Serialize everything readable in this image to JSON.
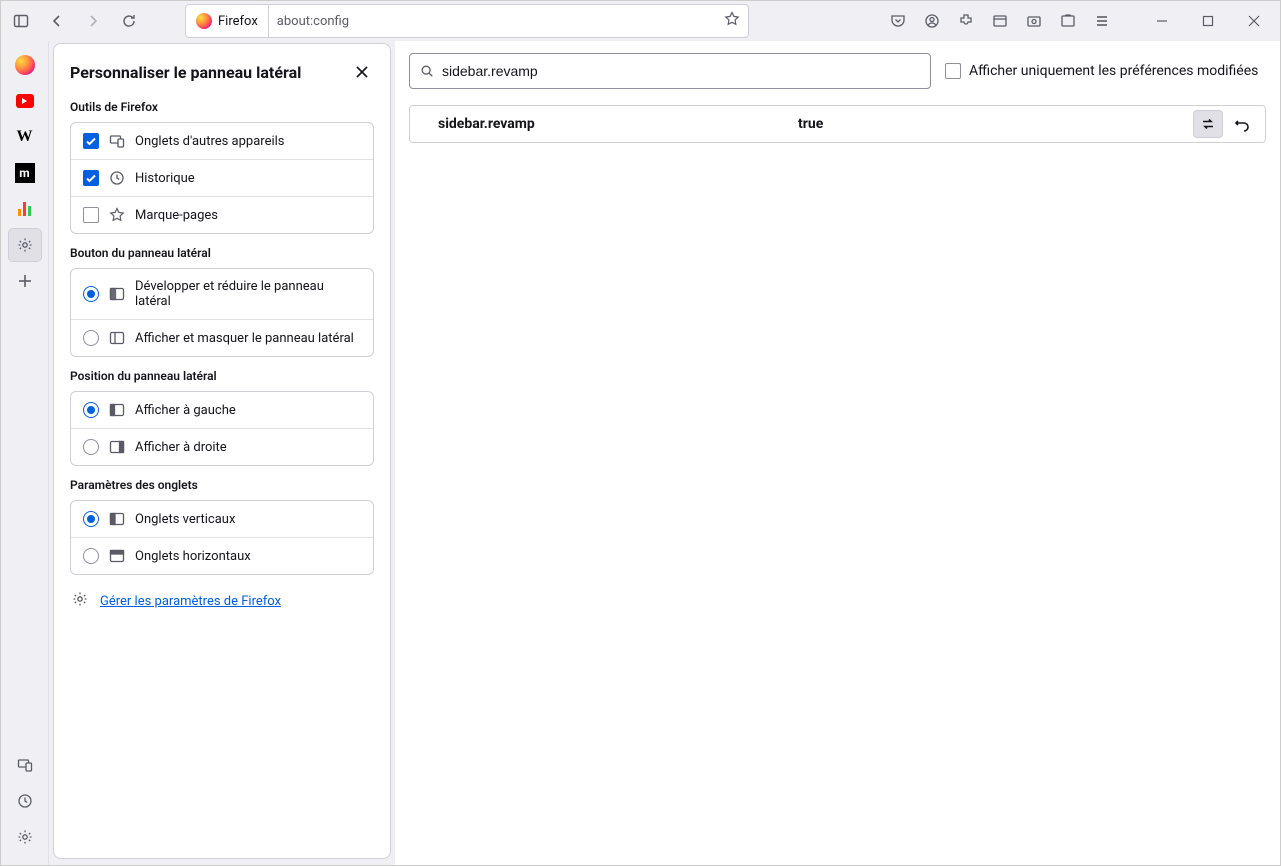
{
  "toolbar": {
    "tab_label": "Firefox",
    "url": "about:config"
  },
  "sidebar_panel": {
    "title": "Personnaliser le panneau latéral",
    "sections": {
      "tools": {
        "label": "Outils de Firefox",
        "items": [
          {
            "label": "Onglets d'autres appareils",
            "checked": true
          },
          {
            "label": "Historique",
            "checked": true
          },
          {
            "label": "Marque-pages",
            "checked": false
          }
        ]
      },
      "button": {
        "label": "Bouton du panneau latéral",
        "items": [
          {
            "label": "Développer et réduire le panneau latéral",
            "selected": true
          },
          {
            "label": "Afficher et masquer le panneau latéral",
            "selected": false
          }
        ]
      },
      "position": {
        "label": "Position du panneau latéral",
        "items": [
          {
            "label": "Afficher à gauche",
            "selected": true
          },
          {
            "label": "Afficher à droite",
            "selected": false
          }
        ]
      },
      "tabs": {
        "label": "Paramètres des onglets",
        "items": [
          {
            "label": "Onglets verticaux",
            "selected": true
          },
          {
            "label": "Onglets horizontaux",
            "selected": false
          }
        ]
      }
    },
    "manage_link": "Gérer les paramètres de Firefox"
  },
  "config": {
    "search_value": "sidebar.revamp",
    "show_modified_label": "Afficher uniquement les préférences modifiées",
    "pref": {
      "name": "sidebar.revamp",
      "value": "true"
    }
  }
}
